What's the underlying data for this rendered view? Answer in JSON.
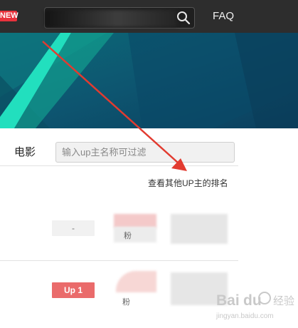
{
  "nav": {
    "new_badge": "NEW",
    "search": {
      "value": "",
      "placeholder": ""
    },
    "faq": "FAQ"
  },
  "filter": {
    "category": "电影",
    "input_placeholder": "输入up主名称可过滤",
    "view_other_link": "查看其他UP主的排名"
  },
  "rows": [
    {
      "rank": "-",
      "partial_text": "粉"
    },
    {
      "rank": "Up 1",
      "partial_text": "粉"
    }
  ],
  "watermark": {
    "brand": "Bai",
    "brand2": "du",
    "sub": "经验",
    "url": "jingyan.baidu.com"
  },
  "colors": {
    "nav_bg": "#2d2d2d",
    "new_badge": "#e8323c",
    "banner_bg": "#0e5a72",
    "banner_stripe": "#1ed8b8",
    "rank_up": "#ea6b6b",
    "annotation_arrow": "#e23b30"
  }
}
